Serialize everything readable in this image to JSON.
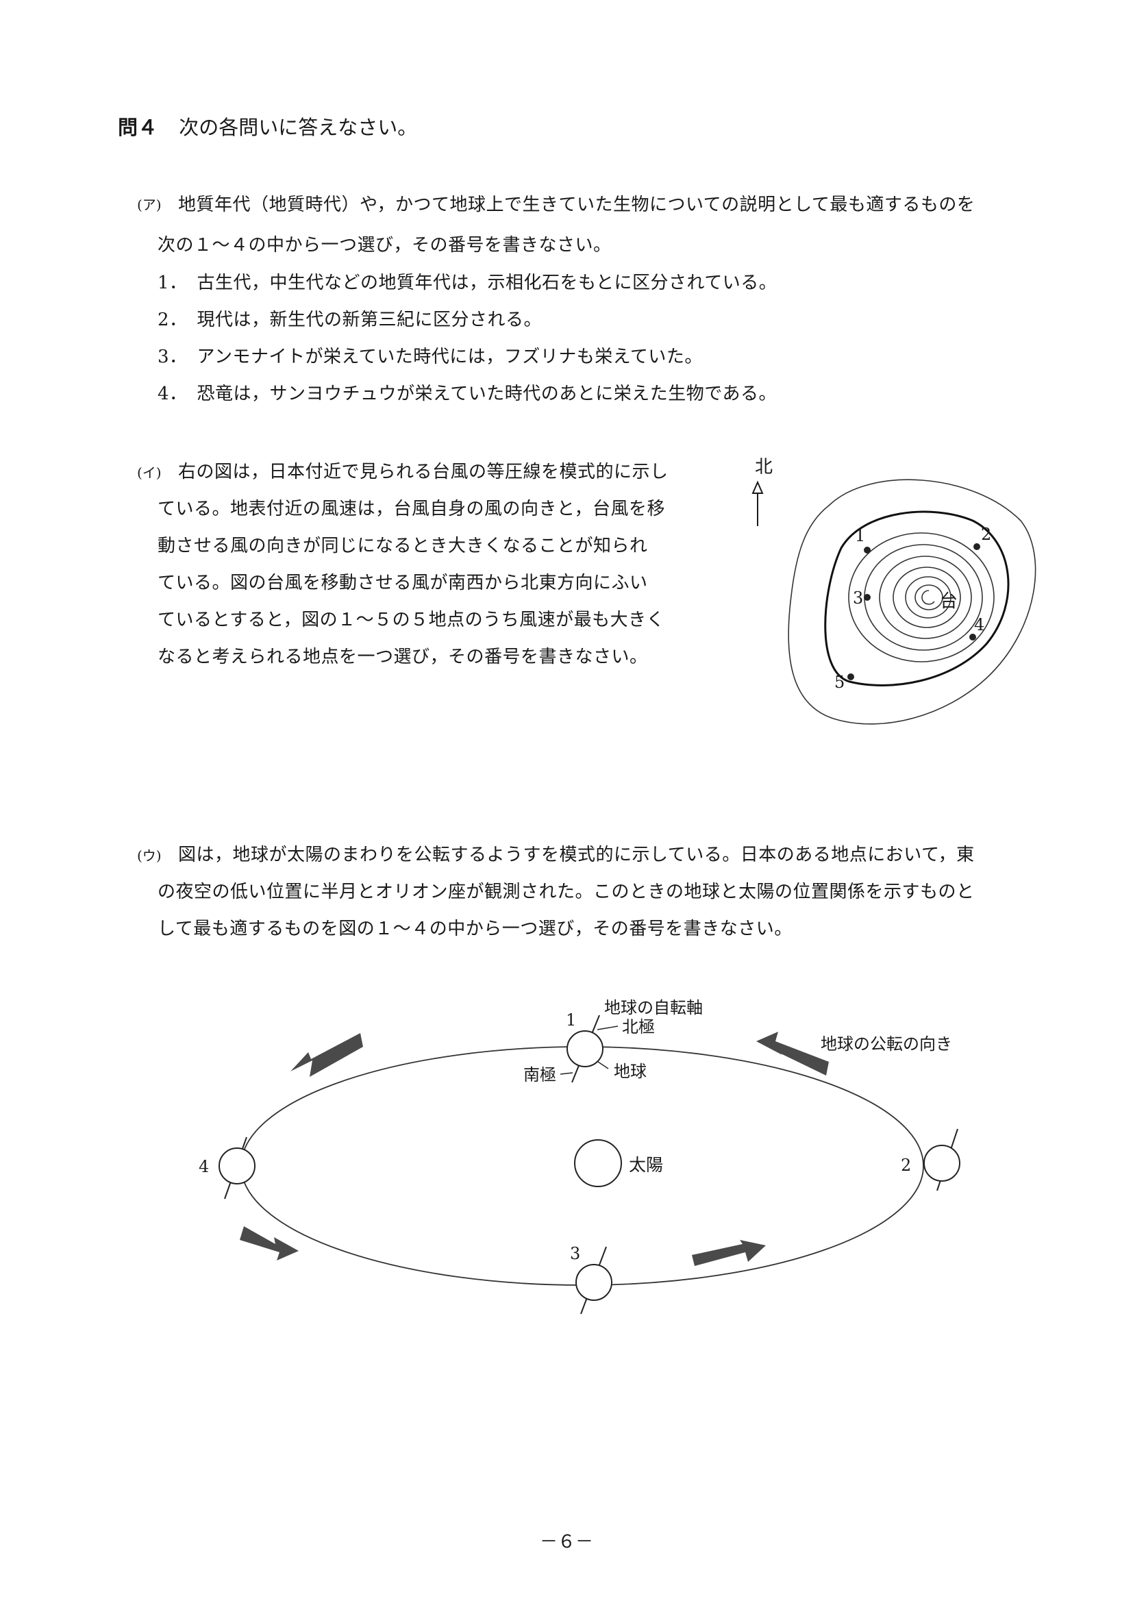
{
  "question": {
    "number": "問４",
    "title": "次の各問いに答えなさい。"
  },
  "part_a": {
    "marker": "(ア)",
    "lines": [
      "地質年代（地質時代）や，かつて地球上で生きていた生物についての説明として最も適するものを",
      "次の１～４の中から一つ選び，その番号を書きなさい。"
    ],
    "options": [
      {
        "no": "1．",
        "text": "古生代，中生代などの地質年代は，示相化石をもとに区分されている。"
      },
      {
        "no": "2．",
        "text": "現代は，新生代の新第三紀に区分される。"
      },
      {
        "no": "3．",
        "text": "アンモナイトが栄えていた時代には，フズリナも栄えていた。"
      },
      {
        "no": "4．",
        "text": "恐竜は，サンヨウチュウが栄えていた時代のあとに栄えた生物である。"
      }
    ]
  },
  "part_b": {
    "marker": "(イ)",
    "lines": [
      "右の図は，日本付近で見られる台風の等圧線を模式的に示し",
      "ている。地表付近の風速は，台風自身の風の向きと，台風を移",
      "動させる風の向きが同じになるとき大きくなることが知られ",
      "ている。図の台風を移動させる風が南西から北東方向にふい",
      "ているとすると，図の１～５の５地点のうち風速が最も大きく",
      "なると考えられる地点を一つ選び，その番号を書きなさい。"
    ],
    "figure": {
      "north_label": "北",
      "typhoon_label": "台",
      "points": [
        "1",
        "2",
        "3",
        "4",
        "5"
      ]
    }
  },
  "part_c": {
    "marker": "(ウ)",
    "lines": [
      "図は，地球が太陽のまわりを公転するようすを模式的に示している。日本のある地点において，東",
      "の夜空の低い位置に半月とオリオン座が観測された。このときの地球と太陽の位置関係を示すものと",
      "して最も適するものを図の１～４の中から一つ選び，その番号を書きなさい。"
    ],
    "figure": {
      "axis_label": "地球の自転軸",
      "north_pole": "北極",
      "south_pole": "南極",
      "earth": "地球",
      "sun": "太陽",
      "revolution_label": "地球の公転の向き",
      "positions": [
        "1",
        "2",
        "3",
        "4"
      ]
    }
  },
  "page_number": "－６－"
}
